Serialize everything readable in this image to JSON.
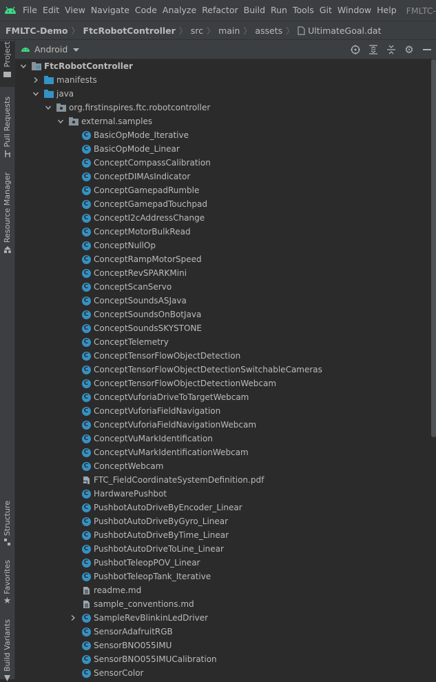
{
  "menubar": {
    "items": [
      "File",
      "Edit",
      "View",
      "Navigate",
      "Code",
      "Analyze",
      "Refactor",
      "Build",
      "Run",
      "Tools",
      "Git",
      "Window",
      "Help"
    ],
    "title": "FMLTC-"
  },
  "breadcrumb": [
    "FMLTC-Demo",
    "FtcRobotController",
    "src",
    "main",
    "assets",
    "UltimateGoal.dat"
  ],
  "toolstrip": {
    "project": "Project",
    "pull_requests": "Pull Requests",
    "resource_manager": "Resource Manager",
    "structure": "Structure",
    "favorites": "Favorites",
    "build_variants": "Build Variants"
  },
  "panel": {
    "view": "Android"
  },
  "tree": {
    "root": "FtcRobotController",
    "manifests": "manifests",
    "java": "java",
    "package": "org.firstinspires.ftc.robotcontroller",
    "external": "external.samples",
    "files": [
      {
        "name": "BasicOpMode_Iterative",
        "type": "class"
      },
      {
        "name": "BasicOpMode_Linear",
        "type": "class"
      },
      {
        "name": "ConceptCompassCalibration",
        "type": "class"
      },
      {
        "name": "ConceptDIMAsIndicator",
        "type": "class"
      },
      {
        "name": "ConceptGamepadRumble",
        "type": "class"
      },
      {
        "name": "ConceptGamepadTouchpad",
        "type": "class"
      },
      {
        "name": "ConceptI2cAddressChange",
        "type": "class"
      },
      {
        "name": "ConceptMotorBulkRead",
        "type": "class"
      },
      {
        "name": "ConceptNullOp",
        "type": "class"
      },
      {
        "name": "ConceptRampMotorSpeed",
        "type": "class"
      },
      {
        "name": "ConceptRevSPARKMini",
        "type": "class"
      },
      {
        "name": "ConceptScanServo",
        "type": "class"
      },
      {
        "name": "ConceptSoundsASJava",
        "type": "class"
      },
      {
        "name": "ConceptSoundsOnBotJava",
        "type": "class"
      },
      {
        "name": "ConceptSoundsSKYSTONE",
        "type": "class"
      },
      {
        "name": "ConceptTelemetry",
        "type": "class"
      },
      {
        "name": "ConceptTensorFlowObjectDetection",
        "type": "class"
      },
      {
        "name": "ConceptTensorFlowObjectDetectionSwitchableCameras",
        "type": "class"
      },
      {
        "name": "ConceptTensorFlowObjectDetectionWebcam",
        "type": "class"
      },
      {
        "name": "ConceptVuforiaDriveToTargetWebcam",
        "type": "class"
      },
      {
        "name": "ConceptVuforiaFieldNavigation",
        "type": "class"
      },
      {
        "name": "ConceptVuforiaFieldNavigationWebcam",
        "type": "class"
      },
      {
        "name": "ConceptVuMarkIdentification",
        "type": "class"
      },
      {
        "name": "ConceptVuMarkIdentificationWebcam",
        "type": "class"
      },
      {
        "name": "ConceptWebcam",
        "type": "class"
      },
      {
        "name": "FTC_FieldCoordinateSystemDefinition.pdf",
        "type": "pdf"
      },
      {
        "name": "HardwarePushbot",
        "type": "class"
      },
      {
        "name": "PushbotAutoDriveByEncoder_Linear",
        "type": "class"
      },
      {
        "name": "PushbotAutoDriveByGyro_Linear",
        "type": "class"
      },
      {
        "name": "PushbotAutoDriveByTime_Linear",
        "type": "class"
      },
      {
        "name": "PushbotAutoDriveToLine_Linear",
        "type": "class"
      },
      {
        "name": "PushbotTeleopPOV_Linear",
        "type": "class"
      },
      {
        "name": "PushbotTeleopTank_Iterative",
        "type": "class"
      },
      {
        "name": "readme.md",
        "type": "md"
      },
      {
        "name": "sample_conventions.md",
        "type": "md"
      },
      {
        "name": "SampleRevBlinkinLedDriver",
        "type": "class",
        "expandable": true
      },
      {
        "name": "SensorAdafruitRGB",
        "type": "class"
      },
      {
        "name": "SensorBNO055IMU",
        "type": "class"
      },
      {
        "name": "SensorBNO055IMUCalibration",
        "type": "class"
      },
      {
        "name": "SensorColor",
        "type": "class"
      }
    ]
  },
  "colors": {
    "background": "#2b2b2b",
    "panel": "#3c3f41",
    "text": "#bbbbbb",
    "folder": "#87939a",
    "class_icon": "#3592c4",
    "android_green": "#3ddc84"
  }
}
